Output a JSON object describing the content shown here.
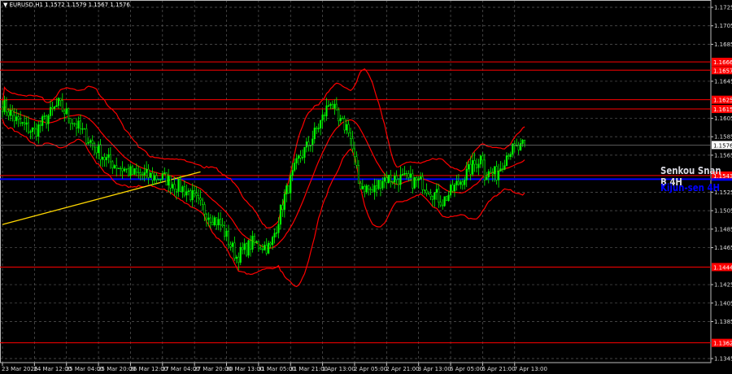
{
  "header": {
    "symbol_line": "EURUSD,H1  1.1572 1.1579 1.1567 1.1576",
    "arrow": "▼"
  },
  "labels": {
    "senkou": "Senkou Snan B 4H",
    "kijun": "Kijun-sen 4H"
  },
  "colors": {
    "bull": "#00ff00",
    "level": "#ff0000",
    "kijun": "#0000ff",
    "trend": "#ffd700",
    "bands": "#ff0000"
  },
  "chart_data": {
    "type": "candlestick",
    "title": "EURUSD,H1",
    "ylim": [
      1.1345,
      1.1725
    ],
    "y_ticks": [
      "1.1725",
      "1.1705",
      "1.1685",
      "1.1645",
      "1.1605",
      "1.1585",
      "1.1565",
      "1.1525",
      "1.1505",
      "1.1485",
      "1.1465",
      "1.1425",
      "1.1405",
      "1.1385",
      "1.1345"
    ],
    "x_ticks": [
      "23 Mar 2026",
      "24 Mar 12:00",
      "25 Mar 04:00",
      "25 Mar 20:00",
      "26 Mar 12:00",
      "27 Mar 04:00",
      "27 Mar 20:00",
      "30 Mar 13:00",
      "31 Mar 05:00",
      "31 Mar 21:00",
      "1 Apr 13:00",
      "2 Apr 05:00",
      "2 Apr 21:00",
      "3 Apr 13:00",
      "6 Apr 05:00",
      "6 Apr 21:00",
      "7 Apr 13:00"
    ],
    "levels": [
      {
        "value": 1.1666,
        "label": "1.1666"
      },
      {
        "value": 1.1657,
        "label": "1.1657"
      },
      {
        "value": 1.1625,
        "label": "1.1625"
      },
      {
        "value": 1.1615,
        "label": "1.1615"
      },
      {
        "value": 1.1543,
        "label": "1.1543"
      },
      {
        "value": 1.1444,
        "label": "1.1444"
      },
      {
        "value": 1.1362,
        "label": "1.1362"
      }
    ],
    "kijun_value": 1.154,
    "current_price": {
      "value": 1.1576,
      "label": "1.1576"
    },
    "trendline": {
      "from_bar": 0,
      "from_price": 1.149,
      "to_bar": 99,
      "to_price": 1.1547
    },
    "close_path_bars": [
      0,
      8,
      16,
      28,
      36,
      44,
      52,
      65,
      81,
      93,
      101,
      109,
      117,
      125,
      134,
      141,
      148,
      154,
      160,
      164,
      168,
      173,
      178,
      185,
      190,
      198,
      210,
      220,
      230,
      240,
      227,
      229,
      233,
      247,
      253,
      259,
      261
    ],
    "close_path": [
      1.162,
      1.16,
      1.159,
      1.162,
      1.16,
      1.158,
      1.156,
      1.1545,
      1.154,
      1.1525,
      1.1505,
      1.149,
      1.1455,
      1.147,
      1.1465,
      1.152,
      1.156,
      1.158,
      1.1605,
      1.1625,
      1.16,
      1.1595,
      1.1535,
      1.1525,
      1.154,
      1.154,
      1.1535,
      1.1515,
      1.154,
      1.1565,
      1.155,
      1.1548,
      1.1545,
      1.1545,
      1.157,
      1.1572,
      1.1576
    ]
  }
}
